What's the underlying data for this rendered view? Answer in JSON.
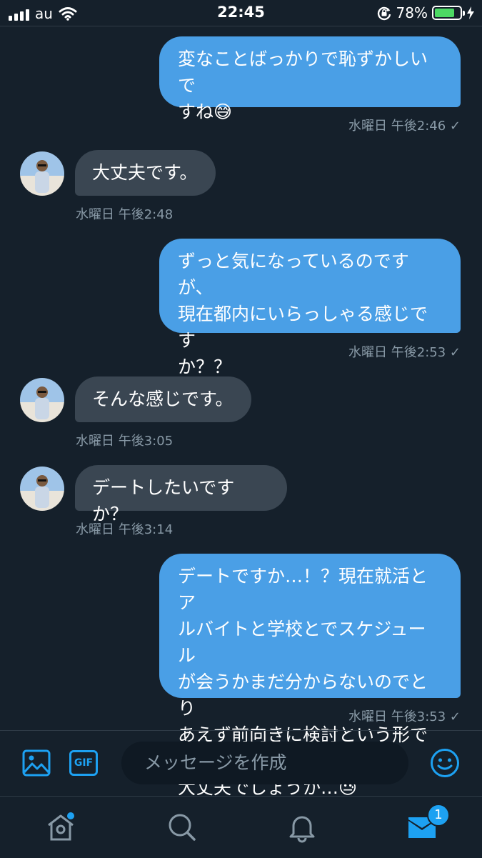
{
  "status_bar": {
    "carrier": "au",
    "time": "22:45",
    "battery_percent": "78%",
    "battery_level": 0.78,
    "battery_color": "#4cd964"
  },
  "conversation": {
    "messages": [
      {
        "direction": "sent",
        "lines": [
          "変なことばっかりで恥ずかしいで",
          "すね😅"
        ],
        "timestamp": "水曜日 午後2:46",
        "read_icon": "checkmark-icon"
      },
      {
        "direction": "received",
        "lines": [
          "大丈夫です。"
        ],
        "timestamp": "水曜日 午後2:48"
      },
      {
        "direction": "sent",
        "lines": [
          "ずっと気になっているのですが、",
          "現在都内にいらっしゃる感じです",
          "か？？"
        ],
        "timestamp": "水曜日 午後2:53",
        "read_icon": "checkmark-icon"
      },
      {
        "direction": "received",
        "lines": [
          "そんな感じです。"
        ],
        "timestamp": "水曜日 午後3:05"
      },
      {
        "direction": "received",
        "lines": [
          "デートしたいですか？"
        ],
        "timestamp": "水曜日 午後3:14"
      },
      {
        "direction": "sent",
        "lines": [
          "デートですか…！？現在就活とア",
          "ルバイトと学校とでスケジュール",
          "が会うかまだ分からないのでとり",
          "あえず前向きに検討という形でも",
          "大丈夫でしょうか…😓"
        ],
        "timestamp": "水曜日 午後3:53",
        "read_icon": "checkmark-icon"
      }
    ]
  },
  "composer": {
    "image_button_icon": "image-icon",
    "gif_label": "GIF",
    "placeholder": "メッセージを作成",
    "emoji_button_icon": "smiley-icon"
  },
  "tab_bar": {
    "items": [
      {
        "name": "home",
        "icon": "home-icon",
        "has_dot": true
      },
      {
        "name": "search",
        "icon": "search-icon"
      },
      {
        "name": "notifications",
        "icon": "bell-icon"
      },
      {
        "name": "messages",
        "icon": "mail-icon",
        "active": true,
        "badge": "1"
      }
    ]
  },
  "colors": {
    "background": "#15202b",
    "sent_bubble": "#4a9fe6",
    "received_bubble": "#3a4652",
    "accent": "#1da1f2",
    "muted_text": "#8899a6"
  }
}
